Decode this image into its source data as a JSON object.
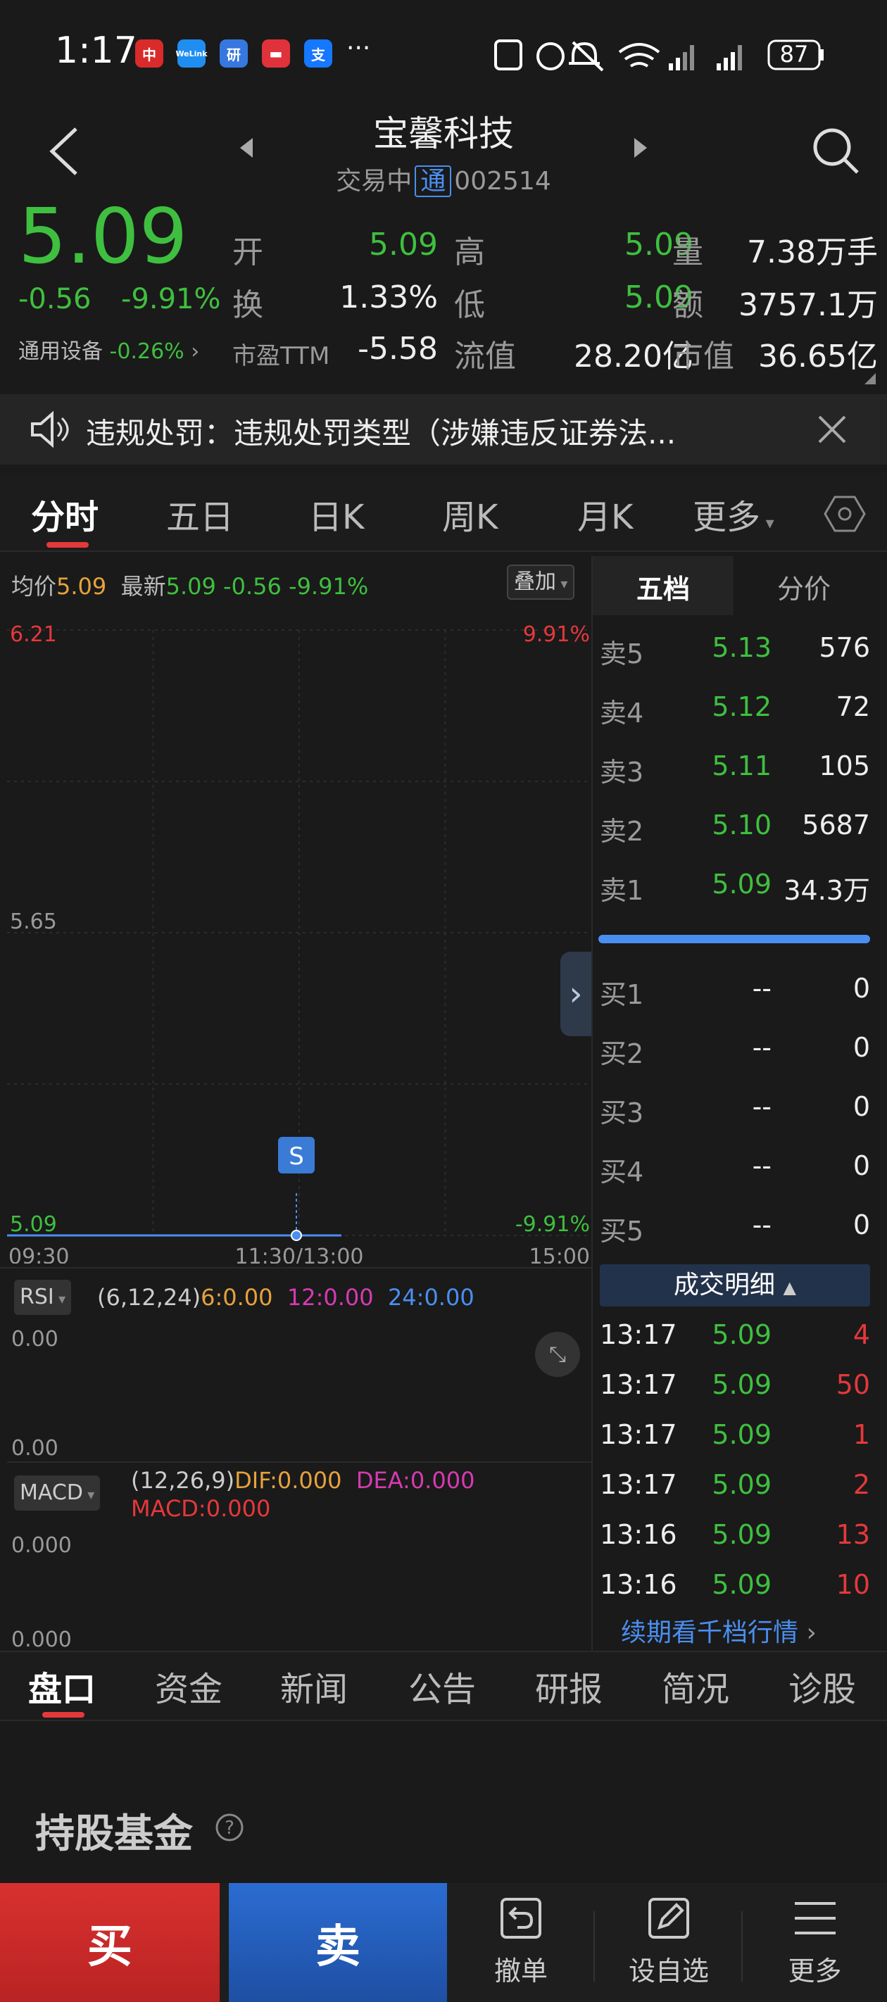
{
  "status": {
    "time": "1:17",
    "battery": "87",
    "dots": "···"
  },
  "header": {
    "title": "宝馨科技",
    "status": "交易中",
    "tong": "通",
    "code": "002514"
  },
  "quote": {
    "price": "5.09",
    "change": "-0.56",
    "change_pct": "-9.91%",
    "sector": "通用设备",
    "sector_pct": "-0.26%",
    "open_label": "开",
    "open": "5.09",
    "turnover_label": "换",
    "turnover": "1.33%",
    "pe_label": "市盈TTM",
    "pe": "-5.58",
    "high_label": "高",
    "high": "5.09",
    "low_label": "低",
    "low": "5.09",
    "float_label": "流值",
    "float_cap": "28.20亿",
    "vol_label": "量",
    "volume": "7.38万手",
    "amt_label": "额",
    "amount": "3757.1万",
    "cap_label": "市值",
    "market_cap": "36.65亿"
  },
  "notice": {
    "text": "违规处罚：违规处罚类型（涉嫌违反证券法..."
  },
  "tabs": [
    "分时",
    "五日",
    "日K",
    "周K",
    "月K",
    "更多"
  ],
  "chart_header": {
    "avg_label": "均价",
    "avg": "5.09",
    "last_label": "最新",
    "last": "5.09",
    "chg": "-0.56",
    "pct": "-9.91%",
    "overlay": "叠加"
  },
  "chart_data": {
    "type": "line",
    "x": [
      "09:30",
      "11:30/13:00",
      "15:00"
    ],
    "series": [],
    "price_value": 5.09,
    "ylim": [
      5.09,
      6.21
    ],
    "y_ticks": [
      "6.21",
      "5.65",
      "5.09"
    ],
    "right_ticks": [
      "9.91%",
      "-9.91%"
    ],
    "marker": "S"
  },
  "rsi": {
    "label": "RSI",
    "params": "(6,12,24)",
    "v6": "6:0.00",
    "v12": "12:0.00",
    "v24": "24:0.00",
    "top": "0.00",
    "bottom": "0.00"
  },
  "macd": {
    "label": "MACD",
    "params": "(12,26,9)",
    "dif": "DIF:0.000",
    "dea": "DEA:0.000",
    "macd": "MACD:0.000",
    "top": "0.000",
    "bottom": "0.000"
  },
  "orderbook": {
    "tab1": "五档",
    "tab2": "分价",
    "sells": [
      {
        "label": "卖5",
        "price": "5.13",
        "vol": "576"
      },
      {
        "label": "卖4",
        "price": "5.12",
        "vol": "72"
      },
      {
        "label": "卖3",
        "price": "5.11",
        "vol": "105"
      },
      {
        "label": "卖2",
        "price": "5.10",
        "vol": "5687"
      },
      {
        "label": "卖1",
        "price": "5.09",
        "vol": "34.3万"
      }
    ],
    "buys": [
      {
        "label": "买1",
        "price": "--",
        "vol": "0"
      },
      {
        "label": "买2",
        "price": "--",
        "vol": "0"
      },
      {
        "label": "买3",
        "price": "--",
        "vol": "0"
      },
      {
        "label": "买4",
        "price": "--",
        "vol": "0"
      },
      {
        "label": "买5",
        "price": "--",
        "vol": "0"
      }
    ],
    "sell_ratio": 1.0,
    "trades_title": "成交明细",
    "trades": [
      {
        "time": "13:17",
        "price": "5.09",
        "vol": "4"
      },
      {
        "time": "13:17",
        "price": "5.09",
        "vol": "50"
      },
      {
        "time": "13:17",
        "price": "5.09",
        "vol": "1"
      },
      {
        "time": "13:17",
        "price": "5.09",
        "vol": "2"
      },
      {
        "time": "13:16",
        "price": "5.09",
        "vol": "13"
      },
      {
        "time": "13:16",
        "price": "5.09",
        "vol": "10"
      }
    ],
    "more_link": "续期看千档行情"
  },
  "bottom_tabs": [
    "盘口",
    "资金",
    "新闻",
    "公告",
    "研报",
    "简况",
    "诊股"
  ],
  "section_title": "持股基金",
  "actions": {
    "buy": "买",
    "sell": "卖",
    "cancel": "撤单",
    "watch": "设自选",
    "more": "更多"
  },
  "colors": {
    "up": "#e5383b",
    "down": "#3fbf3f",
    "accent": "#4a8ff0",
    "bg": "#1a1a1a"
  }
}
